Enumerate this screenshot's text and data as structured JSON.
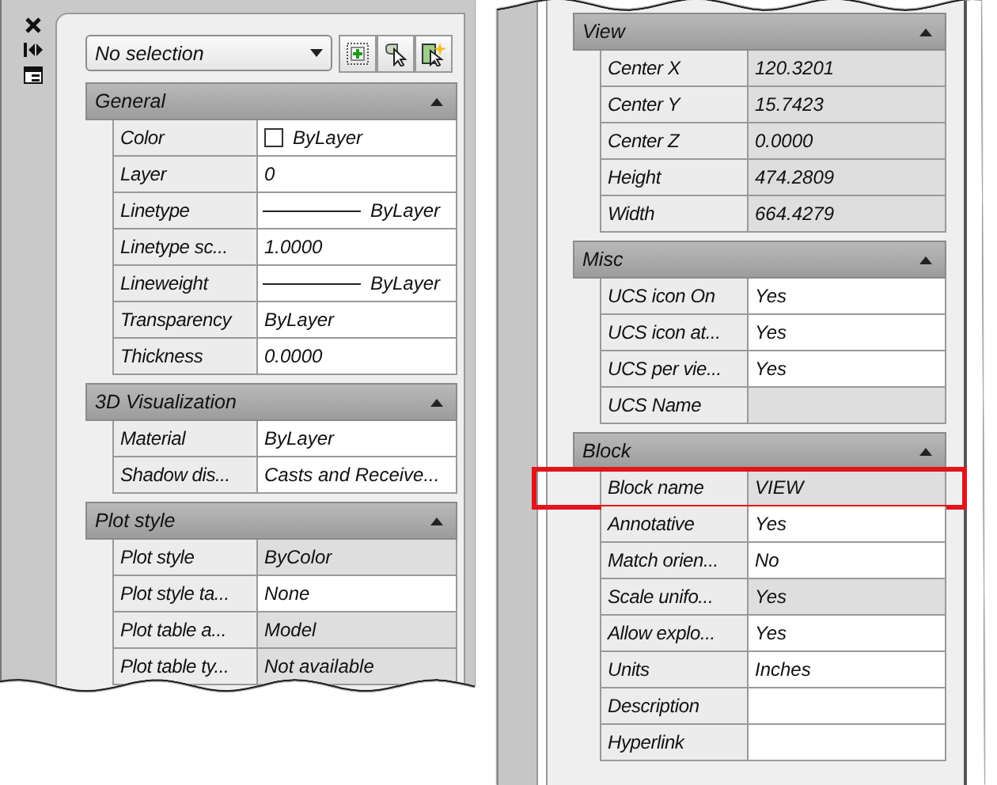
{
  "left_panel": {
    "selection": "No selection",
    "sections": [
      {
        "title": "General",
        "expanded": true,
        "rows": [
          {
            "label": "Color",
            "value": "ByLayer",
            "kind": "swatch",
            "editable": true
          },
          {
            "label": "Layer",
            "value": "0",
            "kind": "text",
            "editable": true
          },
          {
            "label": "Linetype",
            "value": "ByLayer",
            "kind": "line",
            "editable": true
          },
          {
            "label": "Linetype sc...",
            "value": "1.0000",
            "kind": "text",
            "editable": true
          },
          {
            "label": "Lineweight",
            "value": "ByLayer",
            "kind": "line",
            "editable": true
          },
          {
            "label": "Transparency",
            "value": "ByLayer",
            "kind": "text",
            "editable": true
          },
          {
            "label": "Thickness",
            "value": "0.0000",
            "kind": "text",
            "editable": true
          }
        ]
      },
      {
        "title": "3D Visualization",
        "expanded": true,
        "rows": [
          {
            "label": "Material",
            "value": "ByLayer",
            "kind": "text",
            "editable": true
          },
          {
            "label": "Shadow dis...",
            "value": "Casts and Receive...",
            "kind": "text",
            "editable": true
          }
        ]
      },
      {
        "title": "Plot style",
        "expanded": true,
        "rows": [
          {
            "label": "Plot style",
            "value": "ByColor",
            "kind": "text",
            "editable": false
          },
          {
            "label": "Plot style ta...",
            "value": "None",
            "kind": "text",
            "editable": true
          },
          {
            "label": "Plot table a...",
            "value": "Model",
            "kind": "text",
            "editable": false
          },
          {
            "label": "Plot table ty...",
            "value": "Not available",
            "kind": "text",
            "editable": false
          }
        ]
      }
    ]
  },
  "right_panel": {
    "sections": [
      {
        "title": "View",
        "expanded": true,
        "rows": [
          {
            "label": "Center X",
            "value": "120.3201",
            "kind": "text",
            "editable": false
          },
          {
            "label": "Center Y",
            "value": "15.7423",
            "kind": "text",
            "editable": false
          },
          {
            "label": "Center Z",
            "value": "0.0000",
            "kind": "text",
            "editable": false
          },
          {
            "label": "Height",
            "value": "474.2809",
            "kind": "text",
            "editable": false
          },
          {
            "label": "Width",
            "value": "664.4279",
            "kind": "text",
            "editable": false
          }
        ]
      },
      {
        "title": "Misc",
        "expanded": true,
        "rows": [
          {
            "label": "UCS icon On",
            "value": "Yes",
            "kind": "text",
            "editable": true
          },
          {
            "label": "UCS icon at...",
            "value": "Yes",
            "kind": "text",
            "editable": true
          },
          {
            "label": "UCS per vie...",
            "value": "Yes",
            "kind": "text",
            "editable": true
          },
          {
            "label": "UCS Name",
            "kind": "text",
            "editable": false
          }
        ]
      },
      {
        "title": "Block",
        "expanded": true,
        "rows": [
          {
            "label": "Block name",
            "value": "VIEW",
            "kind": "text",
            "editable": false,
            "highlighted": true
          },
          {
            "label": "Annotative",
            "value": "Yes",
            "kind": "text",
            "editable": true
          },
          {
            "label": "Match orien...",
            "value": "No",
            "kind": "text",
            "editable": true
          },
          {
            "label": "Scale unifo...",
            "value": "Yes",
            "kind": "text",
            "editable": false
          },
          {
            "label": "Allow explo...",
            "value": "Yes",
            "kind": "text",
            "editable": true
          },
          {
            "label": "Units",
            "value": "Inches",
            "kind": "text",
            "editable": true
          },
          {
            "label": "Description",
            "kind": "text",
            "editable": true
          },
          {
            "label": "Hyperlink",
            "kind": "text",
            "editable": true
          }
        ]
      }
    ]
  }
}
